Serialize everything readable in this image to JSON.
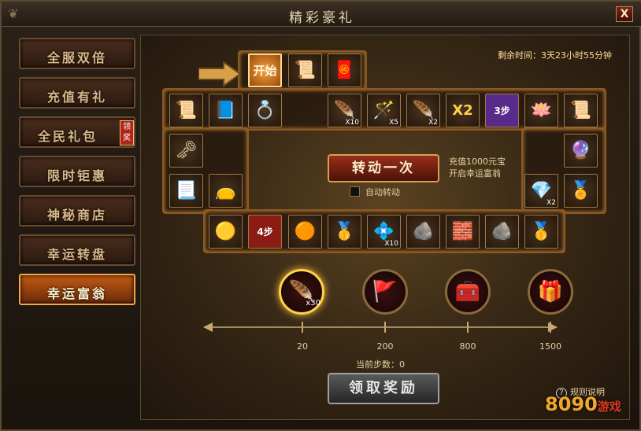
{
  "window": {
    "title": "精彩豪礼",
    "close_label": "X"
  },
  "sidebar": {
    "items": [
      {
        "label": "全服双倍"
      },
      {
        "label": "充值有礼"
      },
      {
        "label": "全民礼包",
        "badge": "领奖"
      },
      {
        "label": "限时钜惠"
      },
      {
        "label": "神秘商店"
      },
      {
        "label": "幸运转盘"
      },
      {
        "label": "幸运富翁",
        "active": true
      }
    ]
  },
  "timer": {
    "text": "剩余时间：3天23小时55分钟"
  },
  "board": {
    "start_label": "开始",
    "cells": {
      "top_row": [
        {
          "icon": "scroll-icon",
          "glyph": "📜"
        },
        {
          "icon": "red-scroll-icon",
          "glyph": "🧧"
        }
      ],
      "row2_left": [
        {
          "icon": "gold-scroll-icon",
          "glyph": "📜"
        },
        {
          "icon": "blue-book-icon",
          "glyph": "📘"
        },
        {
          "icon": "jade-ring-icon",
          "glyph": "💍"
        }
      ],
      "row2_right": [
        {
          "icon": "feather-icon",
          "glyph": "🪶",
          "count": "X10"
        },
        {
          "icon": "blue-wand-icon",
          "glyph": "🪄",
          "count": "X5"
        },
        {
          "icon": "feather-icon",
          "glyph": "🪶",
          "count": "X2"
        },
        {
          "icon": "double-icon",
          "glyph": "X2"
        },
        {
          "icon": "back-3-steps-icon",
          "glyph": "3步"
        },
        {
          "icon": "lotus-icon",
          "glyph": "🪷"
        },
        {
          "icon": "silver-scroll-icon",
          "glyph": "📜"
        }
      ],
      "left_col": [
        {
          "icon": "gold-key-icon",
          "glyph": "🗝"
        },
        {
          "icon": "cloth-scroll-icon",
          "glyph": "📃"
        },
        {
          "icon": "pouch-icon",
          "glyph": "👝"
        }
      ],
      "right_col": [
        {
          "icon": "purple-orb-icon",
          "glyph": "🔮"
        },
        {
          "icon": "red-crystal-icon",
          "glyph": "💎",
          "count": "X2"
        },
        {
          "icon": "gold-medal-icon",
          "glyph": "🏅"
        }
      ],
      "bottom_row": [
        {
          "icon": "gold-orb-icon",
          "glyph": "🟡"
        },
        {
          "icon": "back-4-steps-icon",
          "glyph": "4步"
        },
        {
          "icon": "amber-pearl-icon",
          "glyph": "🟠"
        },
        {
          "icon": "gold-ingot-icon",
          "glyph": "🥇"
        },
        {
          "icon": "cyan-crystal-icon",
          "glyph": "💠",
          "count": "X10"
        },
        {
          "icon": "dark-crystal-icon",
          "glyph": "🪨"
        },
        {
          "icon": "ore-icon",
          "glyph": "🧱"
        },
        {
          "icon": "stone-icon",
          "glyph": "🪨"
        },
        {
          "icon": "gold-ingot-icon",
          "glyph": "🥇"
        }
      ]
    },
    "spin_label": "转动一次",
    "recharge_note_1": "充值1000元宝",
    "recharge_note_2": "开启幸运富翁",
    "auto_label": "自动转动"
  },
  "rewards": {
    "orbs": [
      {
        "icon": "feather-reward-icon",
        "glyph": "🪶",
        "count": "x30"
      },
      {
        "icon": "flag-reward-icon",
        "glyph": "🚩"
      },
      {
        "icon": "chest-reward-icon",
        "glyph": "🧰"
      },
      {
        "icon": "purple-chest-reward-icon",
        "glyph": "🎁"
      }
    ],
    "milestones": [
      "20",
      "200",
      "800",
      "1500"
    ],
    "current_steps": "当前步数：0",
    "claim_label": "领取奖励"
  },
  "help_label": "规则说明",
  "logo": {
    "main": "8090",
    "sub": "游戏"
  },
  "colors": {
    "accent": "#f0a64a",
    "frame": "#5a4a33"
  }
}
